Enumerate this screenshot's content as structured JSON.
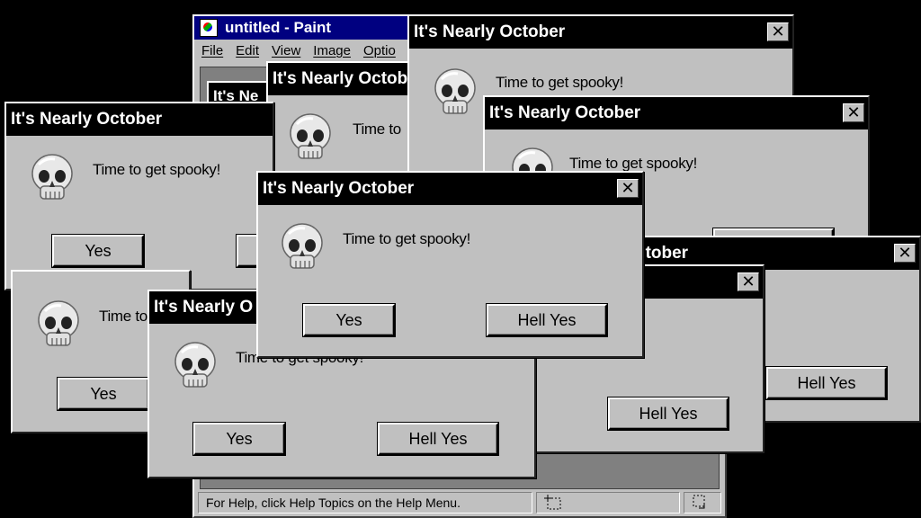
{
  "paint": {
    "title": "untitled - Paint",
    "menu": [
      "File",
      "Edit",
      "View",
      "Image",
      "Optio"
    ],
    "status_text": "For Help, click Help Topics on the Help Menu."
  },
  "dialog": {
    "title": "It's Nearly October",
    "message": "Time to get spooky!",
    "yes_label": "Yes",
    "hell_yes_label": "Hell Yes",
    "close_glyph": "✕"
  },
  "partial_titles": {
    "t1": "It's Ne",
    "t2": "It's Nearly Octob",
    "t3": "ctober",
    "t4": "It's Nearly O"
  },
  "partial_messages": {
    "m1": "Time to",
    "m2": "Time to get spooky!"
  },
  "colors": {
    "titlebar": "#000000",
    "paint_titlebar": "#000080",
    "face": "#c0c0c0"
  },
  "icons": {
    "skull": "skull-icon",
    "close": "close-icon",
    "paint": "paint-app-icon"
  }
}
